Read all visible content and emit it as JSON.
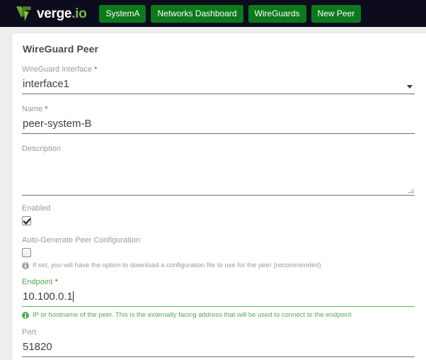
{
  "topbar": {
    "logo_word": "verge",
    "logo_suffix": ".io",
    "logo_icon": "verge-v-logo",
    "breadcrumbs": [
      {
        "label": "SystemA"
      },
      {
        "label": "Networks Dashboard"
      },
      {
        "label": "WireGuards"
      },
      {
        "label": "New Peer"
      }
    ],
    "background_color": "#0c0c1d",
    "crumb_color": "#0c7a1b"
  },
  "form": {
    "title": "WireGuard Peer",
    "interface": {
      "label": "WireGuard Interface",
      "required_marker": "*",
      "value": "interface1"
    },
    "name": {
      "label": "Name",
      "required_marker": "*",
      "value": "peer-system-B"
    },
    "description": {
      "label": "Description",
      "value": ""
    },
    "enabled": {
      "label": "Enabled",
      "checked": true
    },
    "auto_generate": {
      "label": "Auto-Generate Peer Configuration",
      "checked": false,
      "hint": "If set, you will have the option to download a configuration file to use for the peer (recommended)"
    },
    "endpoint": {
      "label": "Endpoint",
      "required_marker": "*",
      "value": "10.100.0.1",
      "hint": "IP or hostname of the peer. This is the externally facing address that will be used to connect to the endpoint",
      "focused": true,
      "focus_color": "#4caf50"
    },
    "port": {
      "label": "Port",
      "value": "51820"
    },
    "required_marker_color": "#c0392b"
  }
}
